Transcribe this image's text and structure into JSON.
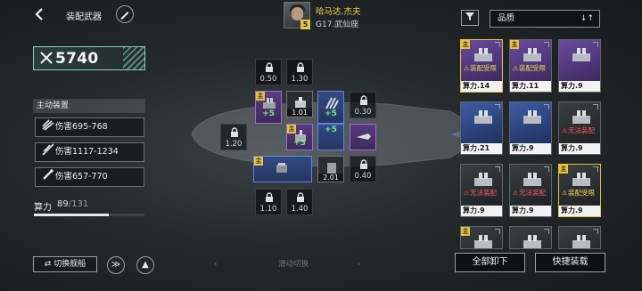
{
  "header": {
    "back_icon": "back-arrow-icon",
    "title": "装配武器",
    "edit_icon": "pencil-icon"
  },
  "pilot": {
    "name": "哈马达.杰夫",
    "ship": "G17.武仙座",
    "rank": "5"
  },
  "power": {
    "icon": "crossed-swords-icon",
    "value": "5740"
  },
  "active_equipment": {
    "header": "主动装置",
    "weapons": [
      {
        "icon": "missile-salvo-icon",
        "text": "伤害695-768"
      },
      {
        "icon": "beam-icon",
        "text": "伤害1117-1234"
      },
      {
        "icon": "rocket-icon",
        "text": "伤害657-770"
      }
    ]
  },
  "compute": {
    "label": "算力",
    "current": "89",
    "max": "/131",
    "fraction": 0.679
  },
  "bottom_left": {
    "switch_ship": "切换舰船",
    "switch_icon": "swap-arrows-icon",
    "btn2_icon": "wing-icon",
    "btn3_icon": "ship-emblem-icon"
  },
  "swipe_hint": "滑动切换",
  "slots": {
    "locked": [
      {
        "req": "0.50"
      },
      {
        "req": "1.30"
      },
      {
        "req": "0.30"
      },
      {
        "req": "1.20"
      },
      {
        "req": "0.40"
      },
      {
        "req": "1.10"
      },
      {
        "req": "1.40"
      }
    ],
    "equipped": [
      {
        "main": "主",
        "plus": "+5",
        "lvl": ""
      },
      {
        "main": "",
        "plus": "",
        "lvl": "1.01"
      },
      {
        "main": "",
        "plus": "+5",
        "lvl": ""
      },
      {
        "main": "主",
        "plus": "+5",
        "lvl": ""
      },
      {
        "main": "",
        "plus": "+5",
        "lvl": ""
      },
      {
        "main": "",
        "plus": "",
        "lvl": ""
      },
      {
        "main": "主",
        "plus": "",
        "lvl": ""
      },
      {
        "main": "",
        "plus": "",
        "lvl": "2.01"
      }
    ]
  },
  "inventory": {
    "filter_icon": "funnel-icon",
    "sort_label": "品质",
    "sort_icon": "sort-toggle-icon",
    "cards": [
      {
        "rarity": "purple",
        "main": "主",
        "status": "装配受限",
        "status_type": "yellow",
        "power": "算力.14",
        "border": "yellow"
      },
      {
        "rarity": "purple",
        "main": "主",
        "status": "装配受限",
        "status_type": "yellow",
        "power": "算力.11",
        "border": ""
      },
      {
        "rarity": "purple",
        "main": "",
        "status": "",
        "status_type": "",
        "power": "算力.9",
        "border": ""
      },
      {
        "rarity": "blue",
        "main": "",
        "status": "",
        "status_type": "",
        "power": "算力.21",
        "border": ""
      },
      {
        "rarity": "blue",
        "main": "",
        "status": "",
        "status_type": "",
        "power": "算力.9",
        "border": ""
      },
      {
        "rarity": "dark",
        "main": "",
        "status": "无法装配",
        "status_type": "red",
        "power": "算力.9",
        "border": ""
      },
      {
        "rarity": "dark",
        "main": "",
        "status": "无法装配",
        "status_type": "red",
        "power": "算力.9",
        "border": ""
      },
      {
        "rarity": "dark",
        "main": "",
        "status": "无法装配",
        "status_type": "red",
        "power": "算力.9",
        "border": ""
      },
      {
        "rarity": "dark",
        "main": "主",
        "status": "装配受限",
        "status_type": "yellow",
        "power": "算力.9",
        "border": "yellow"
      },
      {
        "rarity": "dark",
        "main": "主",
        "status": "",
        "status_type": "",
        "power": "",
        "border": ""
      },
      {
        "rarity": "dark",
        "main": "",
        "status": "",
        "status_type": "",
        "power": "",
        "border": ""
      },
      {
        "rarity": "dark",
        "main": "",
        "status": "",
        "status_type": "",
        "power": "",
        "border": ""
      }
    ],
    "unequip_all": "全部卸下",
    "quick_equip": "快捷装载"
  },
  "colors": {
    "accent_teal": "#7fd3c0",
    "main_tag_yellow": "#e9c23e",
    "limited_yellow": "#f3d64a",
    "cannot_red": "#ff5a5a",
    "purple_rarity": "#6a49a0",
    "blue_rarity": "#3d5ea5"
  }
}
